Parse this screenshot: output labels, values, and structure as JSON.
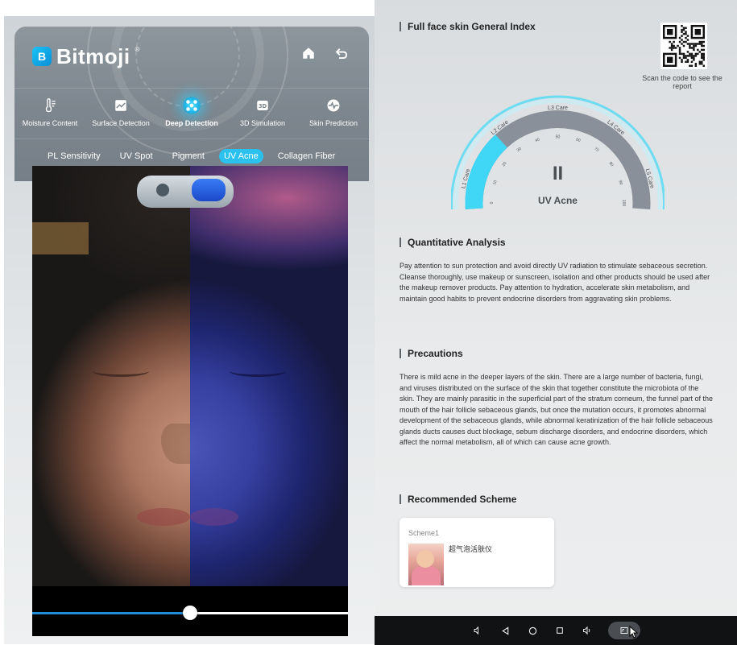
{
  "app": {
    "brand": "Bitmoji",
    "brand_mark": "B",
    "registered": "®"
  },
  "header": {
    "home_icon": "home-icon",
    "back_icon": "back-icon"
  },
  "tabs": [
    {
      "label": "Moisture Content",
      "icon": "thermometer-icon",
      "active": false
    },
    {
      "label": "Surface Detection",
      "icon": "chart-image-icon",
      "active": false
    },
    {
      "label": "Deep Detection",
      "icon": "molecule-icon",
      "active": true
    },
    {
      "label": "3D Simulation",
      "icon": "cube-3d-icon",
      "active": false
    },
    {
      "label": "Skin Prediction",
      "icon": "pulse-icon",
      "active": false
    }
  ],
  "subtabs": [
    {
      "label": "PL Sensitivity",
      "active": false
    },
    {
      "label": "UV Spot",
      "active": false
    },
    {
      "label": "Pigment",
      "active": false
    },
    {
      "label": "UV Acne",
      "active": true
    },
    {
      "label": "Collagen Fiber",
      "active": false
    }
  ],
  "compare_slider": {
    "value": 0.5
  },
  "report": {
    "general_index_title": "Full face skin General Index",
    "qr_label": "Scan the code to see the report",
    "gauge": {
      "score": "II",
      "name": "UV Acne",
      "level_labels": [
        "L1 Care",
        "L2 Care",
        "L3 Care",
        "L4 Care",
        "L5 Care"
      ],
      "tick_labels": [
        "0",
        "10",
        "20",
        "30",
        "40",
        "50",
        "60",
        "70",
        "80",
        "90",
        "100"
      ],
      "value_fraction": 0.2,
      "colors": {
        "active": "#40d6f5",
        "inactive": "#8a9099",
        "outer_ring": "#5fdcf3"
      }
    },
    "quantitative": {
      "title": "Quantitative Analysis",
      "text": "Pay attention to sun protection and avoid directly UV radiation to stimulate sebaceous secretion. Cleanse thoroughly, use makeup or sunscreen, isolation and other products should be used after the makeup remover products. Pay attention to hydration, accelerate skin metabolism, and maintain good habits to prevent endocrine disorders from aggravating skin problems."
    },
    "precautions": {
      "title": "Precautions",
      "text": "There is mild acne in the deeper layers of the skin. There are a large number of bacteria, fungi, and viruses distributed on the surface of the skin that together constitute the microbiota of the skin. They are mainly parasitic in the superficial part of the stratum corneum, the funnel part of the mouth of the hair follicle sebaceous glands, but once the mutation occurs, it promotes abnormal development of the sebaceous glands, while abnormal keratinization of the hair follicle sebaceous glands ducts causes duct blockage, sebum discharge disorders, and endocrine disorders, which affect the normal metabolism, all of which can cause acne growth."
    },
    "recommended": {
      "title": "Recommended Scheme",
      "scheme_label": "Scheme1",
      "product_name": "超气泡活肤仪"
    }
  },
  "system_nav": {
    "icons": [
      "volume-down-icon",
      "back-triangle-icon",
      "home-circle-icon",
      "recents-square-icon",
      "volume-up-icon",
      "screenshot-icon"
    ]
  }
}
